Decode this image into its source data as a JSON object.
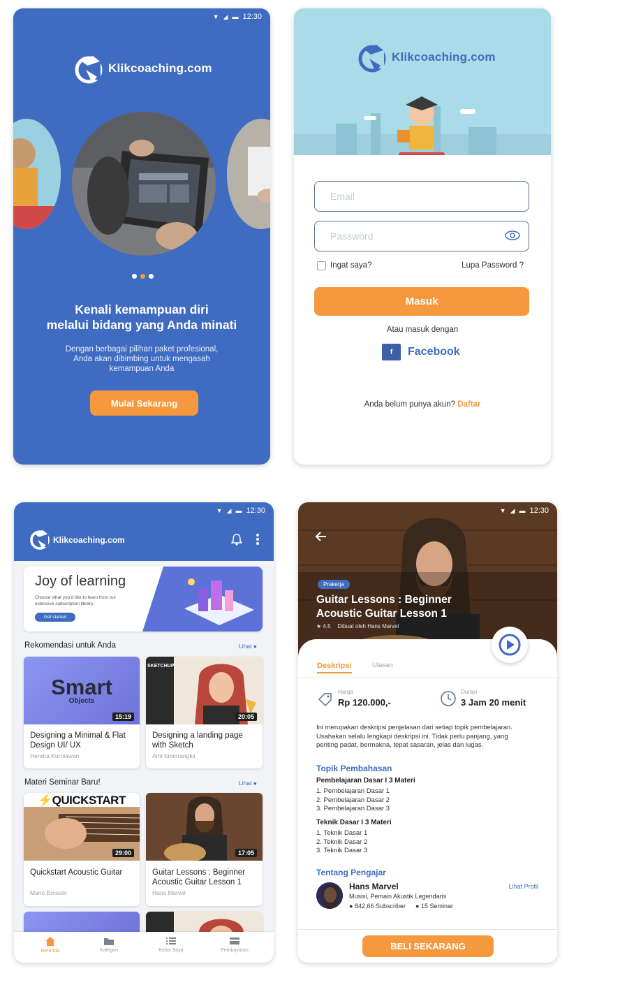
{
  "status_time": "12:30",
  "brand": "Klikcoaching.com",
  "onboarding": {
    "headline": "Kenali kemampuan diri melalui bidang yang Anda minati",
    "headline_line1": "Kenali kemampuan diri",
    "headline_line2": "melalui bidang yang Anda minati",
    "body_line1": "Dengan berbagai pilihan paket profesional,",
    "body_line2": "Anda akan dibimbing untuk mengasah",
    "body_line3": "kemampuan Anda",
    "cta": "Mulai Sekarang",
    "page_count": 3,
    "active_page": 2
  },
  "login": {
    "email_placeholder": "Email",
    "password_placeholder": "Password",
    "remember": "Ingat saya?",
    "forgot": "Lupa Password ?",
    "submit": "Masuk",
    "or_with": "Atau masuk dengan",
    "facebook": "Facebook",
    "no_account": "Anda belum punya akun?",
    "register": "Daftar"
  },
  "home": {
    "banner_title": "Joy of learning",
    "banner_sub": "Choose what you'd like to learn from our extensive subscription library.",
    "banner_cta": "Get started",
    "rec_title": "Rekomendasi untuk Anda",
    "rec_link": "Lihat",
    "seminar_title": "Materi Seminar Baru!",
    "seminar_link": "Lihat",
    "rec_cards": [
      {
        "thumb_text": "Smart",
        "thumb_sub": "Objects",
        "duration": "15:19",
        "title": "Designing a Minimal & Flat Design UI/ UX",
        "author": "Hendra Kurniawan"
      },
      {
        "thumb_text": "SKETCHUP",
        "duration": "20:05",
        "title": "Designing a landing page with Sketch",
        "author": "Ami Simorangkir"
      }
    ],
    "seminar_cards": [
      {
        "thumb_text": "QUICKSTART",
        "duration": "29:00",
        "title": "Quickstart Acoustic Guitar",
        "author": "Mario Ernesto"
      },
      {
        "duration": "17:05",
        "title": "Guitar Lessons : Beginner Acoustic Guitar Lesson 1",
        "author": "Hans Marvel"
      }
    ],
    "nav": [
      "Beranda",
      "Kategori",
      "Kelas Saya",
      "Pembayaran"
    ]
  },
  "detail": {
    "badge": "Prakerja",
    "title_line1": "Guitar Lessons : Beginner",
    "title_line2": "Acoustic Guitar Lesson 1",
    "rating": "4.5",
    "by": "Dibuat oleh Hans Marvel",
    "tabs": [
      "Deskripsi",
      "Ulasan"
    ],
    "price_label": "Harga",
    "price": "Rp 120.000,-",
    "duration_label": "Durasi",
    "duration": "3 Jam 20 menit",
    "desc_line1": "Ini merupakan deskripsi penjelasan dari setiap topik pembelajaran.",
    "desc_line2": "Usahakan selalu lengkapi deskripsi ini. Tidak perlu panjang, yang",
    "desc_line3": "penting padat, bermakna, tepat sasaran, jelas dan lugas.",
    "topics_title": "Topik Pembahasan",
    "group1": "Pembelajaran Dasar I 3 Materi",
    "group1_items": [
      "1. Pembelajaran Dasar 1",
      "2. Pembelajaran Dasar 2",
      "3. Pembelajaran Dasar 3"
    ],
    "group2": "Teknik Dasar I 3 Materi",
    "group2_items": [
      "1. Teknik Dasar 1",
      "2. Teknik Dasar 2",
      "3. Teknik Dasar 3"
    ],
    "teacher_title": "Tentang Pengajar",
    "teacher_name": "Hans Marvel",
    "teacher_desc": "Musisi, Pemain Akustik Legendaris",
    "subscribers": "842,66 Subscriber",
    "seminars": "15 Seminar",
    "profile_link": "Lihat Profil",
    "buy": "BELI SEKARANG"
  },
  "colors": {
    "primary": "#3f6cc0",
    "accent": "#f6993e",
    "sky": "#a9dbe8"
  },
  "icons": [
    "wifi-icon",
    "signal-icon",
    "battery-icon",
    "eye-icon",
    "facebook-icon",
    "bell-icon",
    "more-icon",
    "back-icon",
    "play-icon",
    "tag-icon",
    "clock-icon",
    "home-icon",
    "folder-icon",
    "list-icon",
    "card-icon"
  ]
}
